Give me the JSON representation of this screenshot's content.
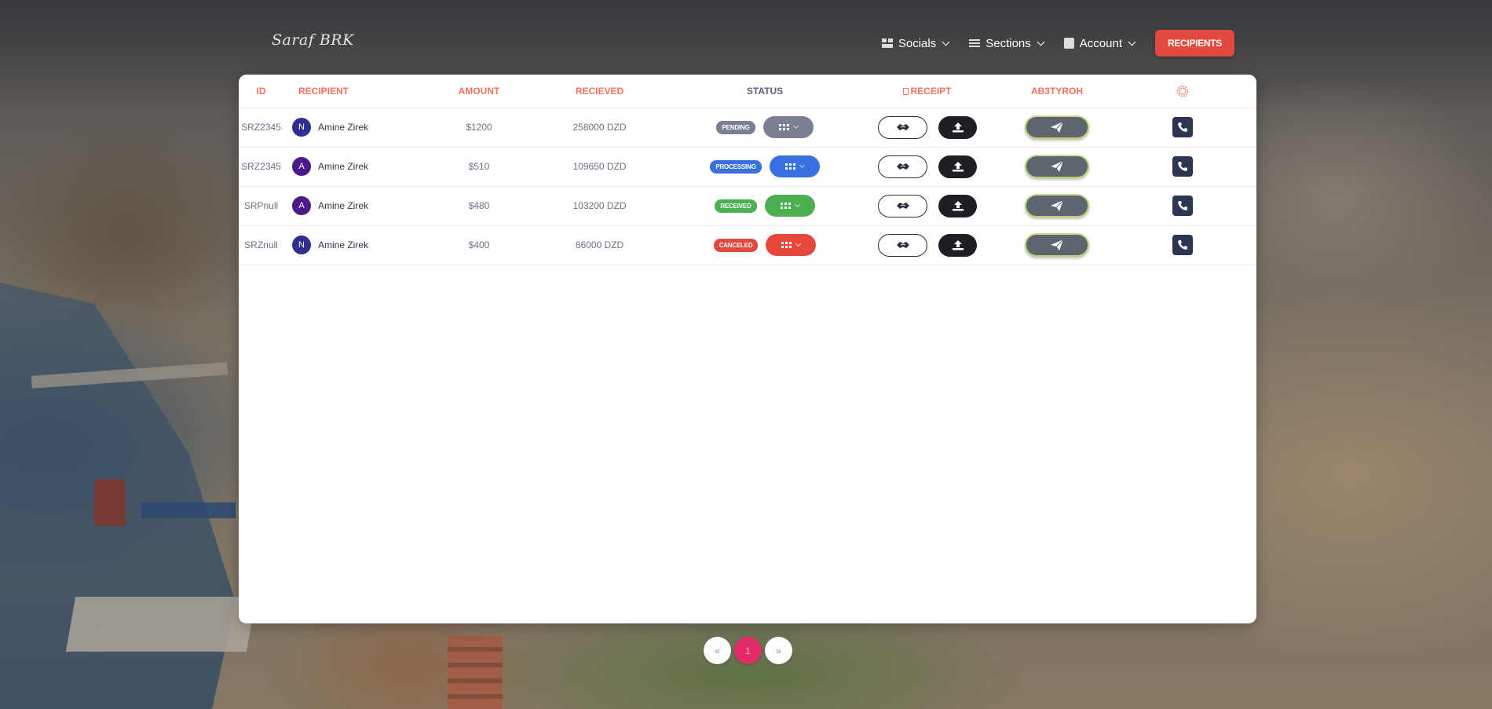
{
  "brand": {
    "logo_text": "Saraf BRK"
  },
  "nav": {
    "items": [
      {
        "label": "Socials",
        "icon": "dashboard-icon"
      },
      {
        "label": "Sections",
        "icon": "list-icon"
      },
      {
        "label": "Account",
        "icon": "contact-card-icon"
      }
    ],
    "cta_label": "RECIPIENTS"
  },
  "colors": {
    "accent": "#f2735e",
    "cta": "#e14a3c",
    "pending": "#7a7f95",
    "processing": "#3a6fe0",
    "received": "#4caf50",
    "canceled": "#e5473a",
    "phone_button": "#2c3552",
    "page_active": "#e22c67"
  },
  "table": {
    "headers": {
      "id": "ID",
      "recipient": "RECIPIENT",
      "amount": "AMOUNT",
      "received": "RECIEVED",
      "status": "STATUS",
      "receipt": "RECEIPT",
      "ab3tyroh": "AB3TYROH"
    },
    "rows": [
      {
        "id": "SRZ2345",
        "initial": "N",
        "avatar_color": "#2f2f8f",
        "name": "Amine Zirek",
        "amount": "$1200",
        "received": "258000 DZD",
        "status": "PENDING",
        "status_color": "#7a7f95"
      },
      {
        "id": "SRZ2345",
        "initial": "A",
        "avatar_color": "#4b1a8a",
        "name": "Amine Zirek",
        "amount": "$510",
        "received": "109650 DZD",
        "status": "PROCESSING",
        "status_color": "#3a6fe0"
      },
      {
        "id": "SRPnull",
        "initial": "A",
        "avatar_color": "#4b1a8a",
        "name": "Amine Zirek",
        "amount": "$480",
        "received": "103200 DZD",
        "status": "RECEIVED",
        "status_color": "#4caf50"
      },
      {
        "id": "SRZnull",
        "initial": "N",
        "avatar_color": "#2f2f8f",
        "name": "Amine Zirek",
        "amount": "$400",
        "received": "86000 DZD",
        "status": "CANCELED",
        "status_color": "#e5473a"
      }
    ]
  },
  "pagination": {
    "prev": "«",
    "current": "1",
    "next": "»"
  }
}
